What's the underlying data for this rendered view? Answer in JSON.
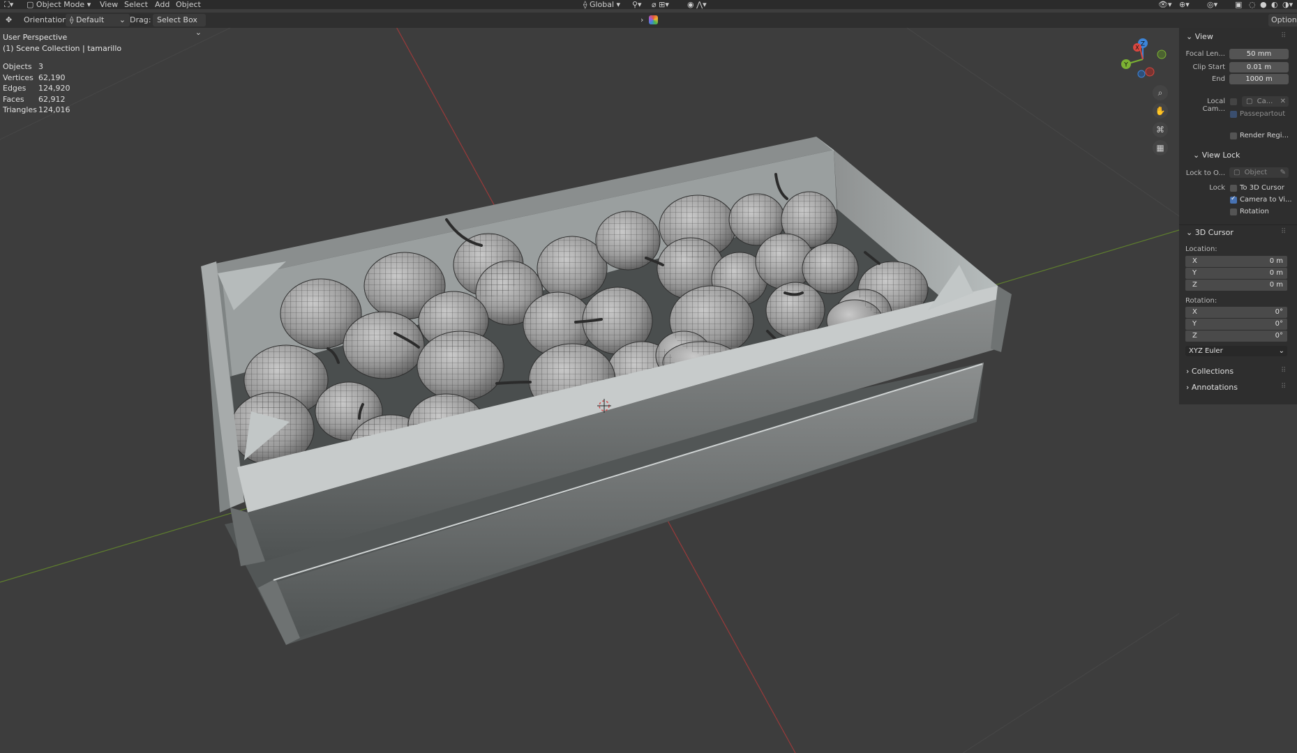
{
  "header": {
    "mode": "Object Mode",
    "menus": [
      "View",
      "Select",
      "Add",
      "Object"
    ],
    "transform_orientation": "Global"
  },
  "tool_header": {
    "orientation_label": "Orientation:",
    "orientation_value": "Default",
    "drag_label": "Drag:",
    "drag_value": "Select Box",
    "options_label": "Options"
  },
  "viewport": {
    "perspective": "User Perspective",
    "collection": "(1) Scene Collection | tamarillo",
    "stats": [
      {
        "label": "Objects",
        "value": "3"
      },
      {
        "label": "Vertices",
        "value": "62,190"
      },
      {
        "label": "Edges",
        "value": "124,920"
      },
      {
        "label": "Faces",
        "value": "62,912"
      },
      {
        "label": "Triangles",
        "value": "124,016"
      }
    ],
    "gizmo": {
      "x": "X",
      "y": "Y",
      "z": "Z"
    }
  },
  "sidebar": {
    "view_title": "View",
    "focal_length_label": "Focal Len...",
    "focal_length_value": "50 mm",
    "clip_start_label": "Clip Start",
    "clip_start_value": "0.01 m",
    "end_label": "End",
    "end_value": "1000 m",
    "local_camera_label": "Local Cam...",
    "local_camera_value": "Ca...",
    "passepartout_label": "Passepartout",
    "render_region_label": "Render Regi...",
    "view_lock_title": "View Lock",
    "lock_to_object_label": "Lock to O...",
    "lock_to_object_value": "Object",
    "lock_label": "Lock",
    "lock_to_cursor_label": "To 3D Cursor",
    "camera_to_view_label": "Camera to Vi...",
    "camera_to_view_checked": true,
    "rotation_lock_label": "Rotation",
    "cursor_title": "3D Cursor",
    "location_label": "Location:",
    "location": [
      {
        "axis": "X",
        "value": "0 m"
      },
      {
        "axis": "Y",
        "value": "0 m"
      },
      {
        "axis": "Z",
        "value": "0 m"
      }
    ],
    "rotation_label": "Rotation:",
    "rotation": [
      {
        "axis": "X",
        "value": "0°"
      },
      {
        "axis": "Y",
        "value": "0°"
      },
      {
        "axis": "Z",
        "value": "0°"
      }
    ],
    "rotation_mode": "XYZ Euler",
    "collections_label": "Collections",
    "annotations_label": "Annotations"
  },
  "colors": {
    "accent": "#4772b3",
    "x_axis_line": "#9a3a3a",
    "y_axis_line": "#5f7f2e",
    "gizmo_x": "#d9463f",
    "gizmo_y": "#7cb233",
    "gizmo_z": "#3d85d9"
  }
}
